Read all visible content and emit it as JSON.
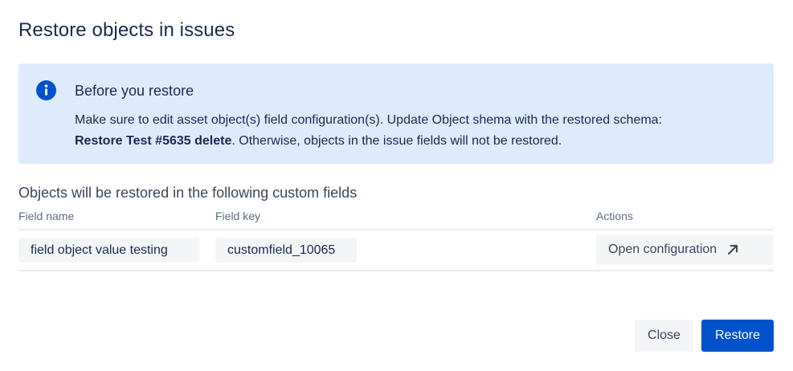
{
  "dialog": {
    "title": "Restore objects in issues"
  },
  "info": {
    "icon": "info-icon",
    "title": "Before you restore",
    "body_line1": "Make sure to edit asset object(s) field configuration(s). Update Object shema with the restored schema:",
    "body_bold": "Restore Test #5635 delete",
    "body_rest": ". Otherwise, objects in the issue fields will not be restored.",
    "accent_color": "#0052cc",
    "background_color": "#deebff"
  },
  "fields": {
    "section_title": "Objects will be restored in the following custom fields",
    "columns": {
      "field_name": "Field name",
      "field_key": "Field key",
      "actions": "Actions"
    },
    "rows": [
      {
        "field_name": "field object value testing",
        "field_key": "customfield_10065",
        "action_label": "Open configuration",
        "action_icon": "external-arrow-icon"
      }
    ]
  },
  "footer": {
    "close_label": "Close",
    "restore_label": "Restore",
    "primary_color": "#0052cc"
  }
}
